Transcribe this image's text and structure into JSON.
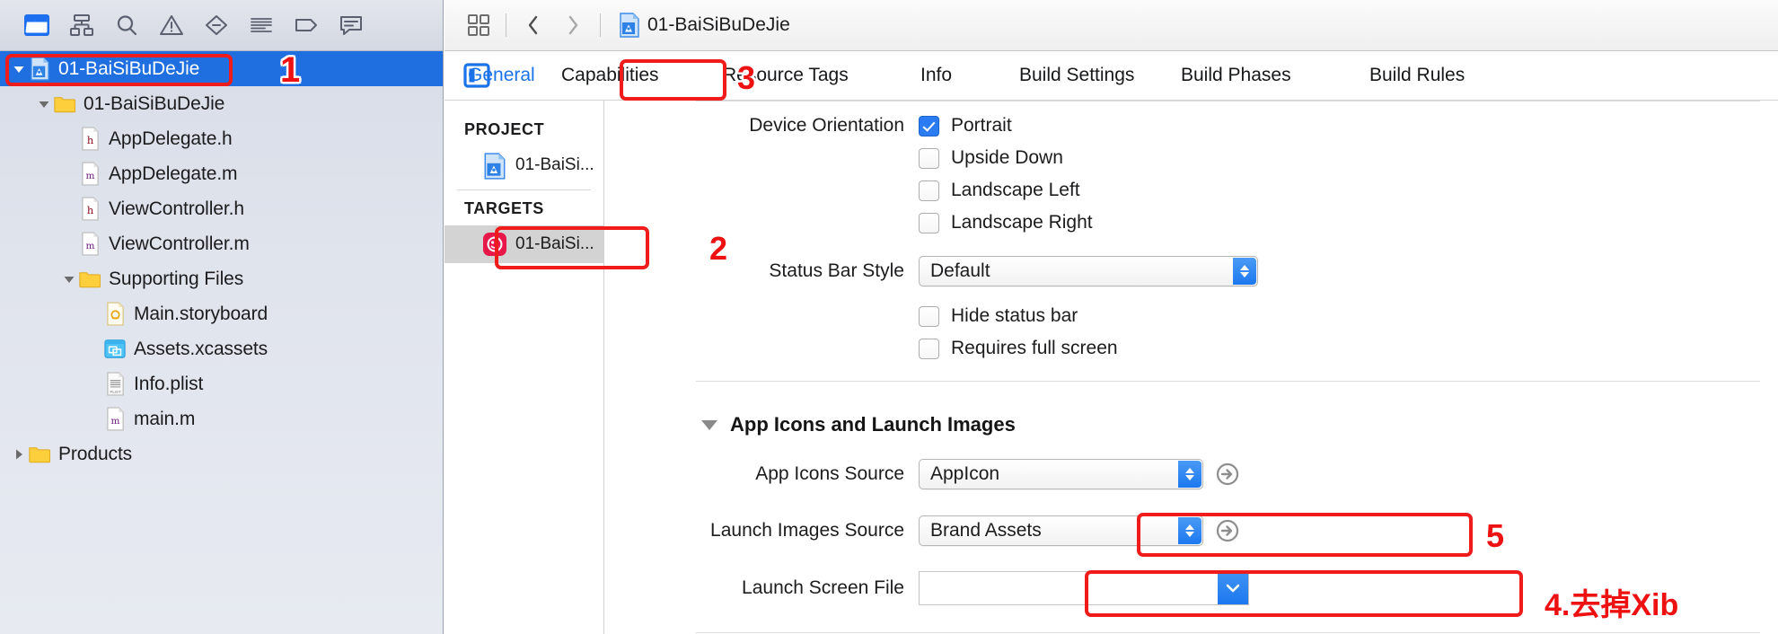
{
  "navigator": {
    "toolbar_icons": [
      {
        "name": "folder-icon",
        "label": "Project navigator"
      },
      {
        "name": "hierarchy-icon",
        "label": "Source control navigator"
      },
      {
        "name": "search-icon",
        "label": "Find navigator"
      },
      {
        "name": "warning-triangle-icon",
        "label": "Issue navigator"
      },
      {
        "name": "test-diamond-icon",
        "label": "Test navigator"
      },
      {
        "name": "debug-list-icon",
        "label": "Debug navigator"
      },
      {
        "name": "tag-icon",
        "label": "Breakpoint navigator"
      },
      {
        "name": "report-bubble-icon",
        "label": "Report navigator"
      }
    ],
    "tree": [
      {
        "label": "01-BaiSiBuDeJie",
        "icon": "xcode-project-icon",
        "indent": 0,
        "disclosure": "down",
        "selected": true
      },
      {
        "label": "01-BaiSiBuDeJie",
        "icon": "folder-yellow-icon",
        "indent": 1,
        "disclosure": "down",
        "selected": false
      },
      {
        "label": "AppDelegate.h",
        "icon": "header-file-icon",
        "indent": 2,
        "disclosure": "none",
        "selected": false
      },
      {
        "label": "AppDelegate.m",
        "icon": "source-file-icon",
        "indent": 2,
        "disclosure": "none",
        "selected": false
      },
      {
        "label": "ViewController.h",
        "icon": "header-file-icon",
        "indent": 2,
        "disclosure": "none",
        "selected": false
      },
      {
        "label": "ViewController.m",
        "icon": "source-file-icon",
        "indent": 2,
        "disclosure": "none",
        "selected": false
      },
      {
        "label": "Supporting Files",
        "icon": "folder-yellow-icon",
        "indent": 2,
        "disclosure": "down",
        "selected": false
      },
      {
        "label": "Main.storyboard",
        "icon": "storyboard-icon",
        "indent": 3,
        "disclosure": "none",
        "selected": false
      },
      {
        "label": "Assets.xcassets",
        "icon": "assets-catalog-icon",
        "indent": 3,
        "disclosure": "none",
        "selected": false
      },
      {
        "label": "Info.plist",
        "icon": "plist-file-icon",
        "indent": 3,
        "disclosure": "none",
        "selected": false
      },
      {
        "label": "main.m",
        "icon": "source-file-icon",
        "indent": 3,
        "disclosure": "none",
        "selected": false
      },
      {
        "label": "Products",
        "icon": "folder-yellow-icon",
        "indent": 0,
        "disclosure": "right",
        "selected": false
      }
    ]
  },
  "editor_toolbar": {
    "grid_icon": "related-items-icon",
    "back_icon": "chevron-left-icon",
    "forward_icon": "chevron-right-icon",
    "breadcrumb_icon": "xcode-project-icon",
    "breadcrumb_title": "01-BaiSiBuDeJie"
  },
  "tabs": {
    "panel_toggle_icon": "left-panel-toggle-icon",
    "items": [
      {
        "label": "General",
        "active": true
      },
      {
        "label": "Capabilities",
        "active": false
      },
      {
        "label": "Resource Tags",
        "active": false
      },
      {
        "label": "Info",
        "active": false
      },
      {
        "label": "Build Settings",
        "active": false
      },
      {
        "label": "Build Phases",
        "active": false
      },
      {
        "label": "Build Rules",
        "active": false
      }
    ]
  },
  "target_list": {
    "project_header": "PROJECT",
    "project_item": {
      "label": "01-BaiSi...",
      "icon": "xcode-project-icon"
    },
    "targets_header": "TARGETS",
    "target_item": {
      "label": "01-BaiSi...",
      "icon": "app-target-icon",
      "selected": true
    }
  },
  "general": {
    "device_orientation": {
      "label": "Device Orientation",
      "options": [
        {
          "label": "Portrait",
          "checked": true
        },
        {
          "label": "Upside Down",
          "checked": false
        },
        {
          "label": "Landscape Left",
          "checked": false
        },
        {
          "label": "Landscape Right",
          "checked": false
        }
      ]
    },
    "status_bar_style": {
      "label": "Status Bar Style",
      "value": "Default"
    },
    "hide_status_bar": {
      "label": "Hide status bar",
      "checked": false
    },
    "requires_full_screen": {
      "label": "Requires full screen",
      "checked": false
    },
    "app_icons_section": {
      "title": "App Icons and Launch Images",
      "app_icons_source": {
        "label": "App Icons Source",
        "value": "AppIcon"
      },
      "launch_images_source": {
        "label": "Launch Images Source",
        "value": "Brand Assets"
      },
      "launch_screen_file": {
        "label": "Launch Screen File",
        "value": ""
      }
    }
  },
  "annotations": {
    "colors": {
      "highlight": "#f01c1c",
      "number": "#ee1111"
    },
    "markers": [
      {
        "id": "1",
        "text": "1"
      },
      {
        "id": "2",
        "text": "2"
      },
      {
        "id": "3",
        "text": "3"
      },
      {
        "id": "5",
        "text": "5"
      },
      {
        "id": "4",
        "text": "4.去掉Xib"
      }
    ]
  }
}
